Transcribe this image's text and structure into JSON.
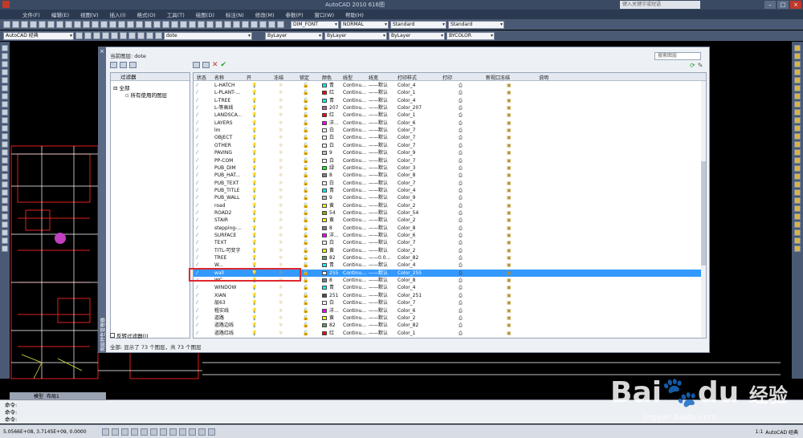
{
  "window": {
    "title": "AutoCAD 2010    616图",
    "search_placeholder": "键入关键字或短语"
  },
  "menu": [
    "文件(F)",
    "编辑(E)",
    "视图(V)",
    "插入(I)",
    "格式(O)",
    "工具(T)",
    "绘图(D)",
    "标注(N)",
    "修改(M)",
    "参数(P)",
    "窗口(W)",
    "帮助(H)"
  ],
  "toolbar": {
    "text_style": "DIM_FONT",
    "dim_style": "NORMAL",
    "table_style": "Standard",
    "multileader_style": "Standard",
    "workspace": "AutoCAD 经典",
    "layer_combo": "dote",
    "color": "ByLayer",
    "linetype": "ByLayer",
    "lineweight": "ByLayer",
    "plotstyle": "BYCOLOR"
  },
  "dialog": {
    "current_layer": "当前图层: dote",
    "search_placeholder": "搜索图层",
    "side_label": "图层特性管理器",
    "filter_header": "过滤器",
    "filter_all": "全部",
    "filter_used": "所有使用的图层",
    "invert_filter": "反转过滤器(I)",
    "status": "全部: 显示了 73 个图层，共 73 个图层",
    "columns": [
      "状态",
      "名称",
      "开",
      "冻结",
      "锁定",
      "颜色",
      "线型",
      "线宽",
      "打印样式",
      "打印",
      "新视口冻结",
      "说明"
    ],
    "rows": [
      {
        "name": "L-HATCH",
        "color": "青",
        "hex": "#00ffff",
        "lt": "Continu...",
        "lw": "默认",
        "ps": "Color_4"
      },
      {
        "name": "L-PLANT-...",
        "color": "红",
        "hex": "#ff0000",
        "lt": "Continu...",
        "lw": "默认",
        "ps": "Color_1"
      },
      {
        "name": "L-TREE",
        "color": "青",
        "hex": "#00ffff",
        "lt": "Continu...",
        "lw": "默认",
        "ps": "Color_4"
      },
      {
        "name": "L-等高线",
        "color": "207",
        "hex": "#c060a0",
        "lt": "Continu...",
        "lw": "默认",
        "ps": "Color_207"
      },
      {
        "name": "LANDSCA...",
        "color": "红",
        "hex": "#ff0000",
        "lt": "Continu...",
        "lw": "默认",
        "ps": "Color_1"
      },
      {
        "name": "LAYERS",
        "color": "洋...",
        "hex": "#ff00ff",
        "lt": "Continu...",
        "lw": "默认",
        "ps": "Color_6"
      },
      {
        "name": "lm",
        "color": "白",
        "hex": "#ffffff",
        "lt": "Continu...",
        "lw": "默认",
        "ps": "Color_7"
      },
      {
        "name": "OBJECT",
        "color": "白",
        "hex": "#ffffff",
        "lt": "Continu...",
        "lw": "默认",
        "ps": "Color_7"
      },
      {
        "name": "OTHER",
        "color": "白",
        "hex": "#ffffff",
        "lt": "Continu...",
        "lw": "默认",
        "ps": "Color_7"
      },
      {
        "name": "PAVING",
        "color": "9",
        "hex": "#c0c0c0",
        "lt": "Continu...",
        "lw": "默认",
        "ps": "Color_9"
      },
      {
        "name": "PP-COM",
        "color": "白",
        "hex": "#ffffff",
        "lt": "Continu...",
        "lw": "默认",
        "ps": "Color_7"
      },
      {
        "name": "PUB_DIM",
        "color": "绿",
        "hex": "#00ff00",
        "lt": "Continu...",
        "lw": "默认",
        "ps": "Color_3"
      },
      {
        "name": "PUB_HAT...",
        "color": "8",
        "hex": "#808080",
        "lt": "Continu...",
        "lw": "默认",
        "ps": "Color_8"
      },
      {
        "name": "PUB_TEXT",
        "color": "白",
        "hex": "#ffffff",
        "lt": "Continu...",
        "lw": "默认",
        "ps": "Color_7"
      },
      {
        "name": "PUB_TITLE",
        "color": "青",
        "hex": "#00ffff",
        "lt": "Continu...",
        "lw": "默认",
        "ps": "Color_4"
      },
      {
        "name": "PUB_WALL",
        "color": "9",
        "hex": "#c0c0c0",
        "lt": "Continu...",
        "lw": "默认",
        "ps": "Color_9"
      },
      {
        "name": "road",
        "color": "黄",
        "hex": "#ffff00",
        "lt": "Continu...",
        "lw": "默认",
        "ps": "Color_2"
      },
      {
        "name": "ROAD2",
        "color": "54",
        "hex": "#a0a000",
        "lt": "Continu...",
        "lw": "默认",
        "ps": "Color_54"
      },
      {
        "name": "STAIR",
        "color": "黄",
        "hex": "#ffff00",
        "lt": "Continu...",
        "lw": "默认",
        "ps": "Color_2"
      },
      {
        "name": "stepping-...",
        "color": "8",
        "hex": "#808080",
        "lt": "Continu...",
        "lw": "默认",
        "ps": "Color_8"
      },
      {
        "name": "SURFACE",
        "color": "洋...",
        "hex": "#ff00ff",
        "lt": "Continu...",
        "lw": "默认",
        "ps": "Color_6"
      },
      {
        "name": "TEXT",
        "color": "白",
        "hex": "#ffffff",
        "lt": "Continu...",
        "lw": "默认",
        "ps": "Color_7"
      },
      {
        "name": "TITL-可变字",
        "color": "黄",
        "hex": "#ffff00",
        "lt": "Continu...",
        "lw": "默认",
        "ps": "Color_2"
      },
      {
        "name": "TREE",
        "color": "82",
        "hex": "#60a060",
        "lt": "Continu...",
        "lw": "0.0...",
        "ps": "Color_82"
      },
      {
        "name": "W...",
        "color": "青",
        "hex": "#00ffff",
        "lt": "Continu...",
        "lw": "默认",
        "ps": "Color_4"
      },
      {
        "name": "wall",
        "color": "255",
        "hex": "#ffffff",
        "lt": "Continu...",
        "lw": "默认",
        "ps": "Color_255",
        "selected": true
      },
      {
        "name": "WC",
        "color": "8",
        "hex": "#808080",
        "lt": "Continu...",
        "lw": "默认",
        "ps": "Color_8"
      },
      {
        "name": "WINDOW",
        "color": "青",
        "hex": "#00ffff",
        "lt": "Continu...",
        "lw": "默认",
        "ps": "Color_4"
      },
      {
        "name": "XIAN",
        "color": "251",
        "hex": "#505050",
        "lt": "Continu...",
        "lw": "默认",
        "ps": "Color_251"
      },
      {
        "name": "层63",
        "color": "白",
        "hex": "#ffffff",
        "lt": "Continu...",
        "lw": "默认",
        "ps": "Color_7"
      },
      {
        "name": "粗实线",
        "color": "洋...",
        "hex": "#ff00ff",
        "lt": "Continu...",
        "lw": "默认",
        "ps": "Color_6"
      },
      {
        "name": "道路",
        "color": "黄",
        "hex": "#ffff00",
        "lt": "Continu...",
        "lw": "默认",
        "ps": "Color_2"
      },
      {
        "name": "道路边线",
        "color": "82",
        "hex": "#60a060",
        "lt": "Continu...",
        "lw": "默认",
        "ps": "Color_82"
      },
      {
        "name": "道路红线",
        "color": "红",
        "hex": "#ff0000",
        "lt": "Continu...",
        "lw": "默认",
        "ps": "Color_1"
      }
    ]
  },
  "model_tabs": [
    "模型",
    "布局1"
  ],
  "command": {
    "line1": "命令:",
    "line2": "命令:",
    "line3": "命令:"
  },
  "status": {
    "coords": "5.0566E+08, 3.7145E+09, 0.0000",
    "scale": "1:1",
    "workspace": "AutoCAD 经典"
  },
  "watermark": {
    "brand": "Bai",
    "brand2": "du",
    "brand3": "经验",
    "url": "jingyan.baidu.com"
  },
  "colors": {
    "accent": "#3399ff",
    "highlight_box": "#e0282e",
    "title": "#3a4a63"
  }
}
